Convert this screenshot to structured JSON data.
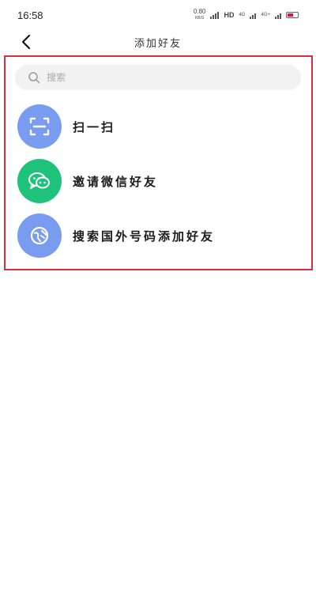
{
  "status_bar": {
    "time": "16:58",
    "net_speed_value": "0.80",
    "net_speed_unit": "KB/S",
    "network_label": "HD",
    "signal_1_label": "4G",
    "signal_2_label": "4G+"
  },
  "header": {
    "title": "添加好友"
  },
  "search": {
    "placeholder": "搜索"
  },
  "options": [
    {
      "label": "扫一扫",
      "icon": "scan-icon",
      "color": "#7a9cf0"
    },
    {
      "label": "邀请微信好友",
      "icon": "wechat-icon",
      "color": "#1ec27a"
    },
    {
      "label": "搜索国外号码添加好友",
      "icon": "globe-icon",
      "color": "#7a9cf0"
    }
  ],
  "colors": {
    "highlight_border": "#d4303c",
    "search_bg": "#f2f2f2"
  }
}
